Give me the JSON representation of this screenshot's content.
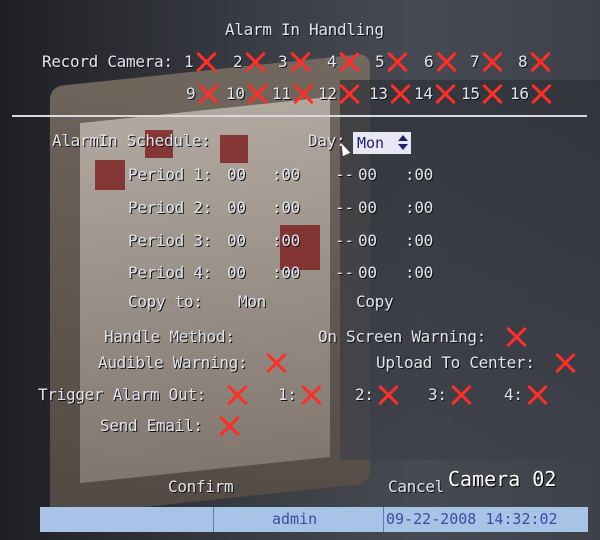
{
  "title": "Alarm In Handling",
  "record_camera": {
    "label": "Record Camera:",
    "row1": [
      "1",
      "2",
      "3",
      "4",
      "5",
      "6",
      "7",
      "8"
    ],
    "row2": [
      "9",
      "10",
      "11",
      "12",
      "13",
      "14",
      "15",
      "16"
    ]
  },
  "schedule": {
    "label": "AlarmIn Schedule:",
    "day_label": "Day:",
    "day_value": "Mon",
    "periods": [
      {
        "label": "Period 1:",
        "start_h": "00",
        "start_m": ":00",
        "dash": "--",
        "end_h": "00",
        "end_m": ":00"
      },
      {
        "label": "Period 2:",
        "start_h": "00",
        "start_m": ":00",
        "dash": "--",
        "end_h": "00",
        "end_m": ":00"
      },
      {
        "label": "Period 3:",
        "start_h": "00",
        "start_m": ":00",
        "dash": "--",
        "end_h": "00",
        "end_m": ":00"
      },
      {
        "label": "Period 4:",
        "start_h": "00",
        "start_m": ":00",
        "dash": "--",
        "end_h": "00",
        "end_m": ":00"
      }
    ],
    "copy_to_label": "Copy to:",
    "copy_to_value": "Mon",
    "copy_button": "Copy"
  },
  "handle": {
    "method_label": "Handle Method:",
    "on_screen_warning": "On Screen Warning:",
    "audible_warning": "Audible Warning:",
    "upload_to_center": "Upload To Center:",
    "trigger_alarm_out": "Trigger Alarm Out:",
    "alarm_outs": [
      "1:",
      "2:",
      "3:",
      "4:"
    ],
    "send_email": "Send Email:"
  },
  "buttons": {
    "confirm": "Confirm",
    "cancel": "Cancel"
  },
  "overlay": {
    "camera": "Camera 02"
  },
  "status": {
    "user": "admin",
    "datetime": "09-22-2008 14:32:02"
  },
  "colors": {
    "x_mark": "#ff2e26",
    "osd_text": "#e4e4ee",
    "status_bg": "#a7c4e6",
    "status_text": "#3b4aa6"
  }
}
